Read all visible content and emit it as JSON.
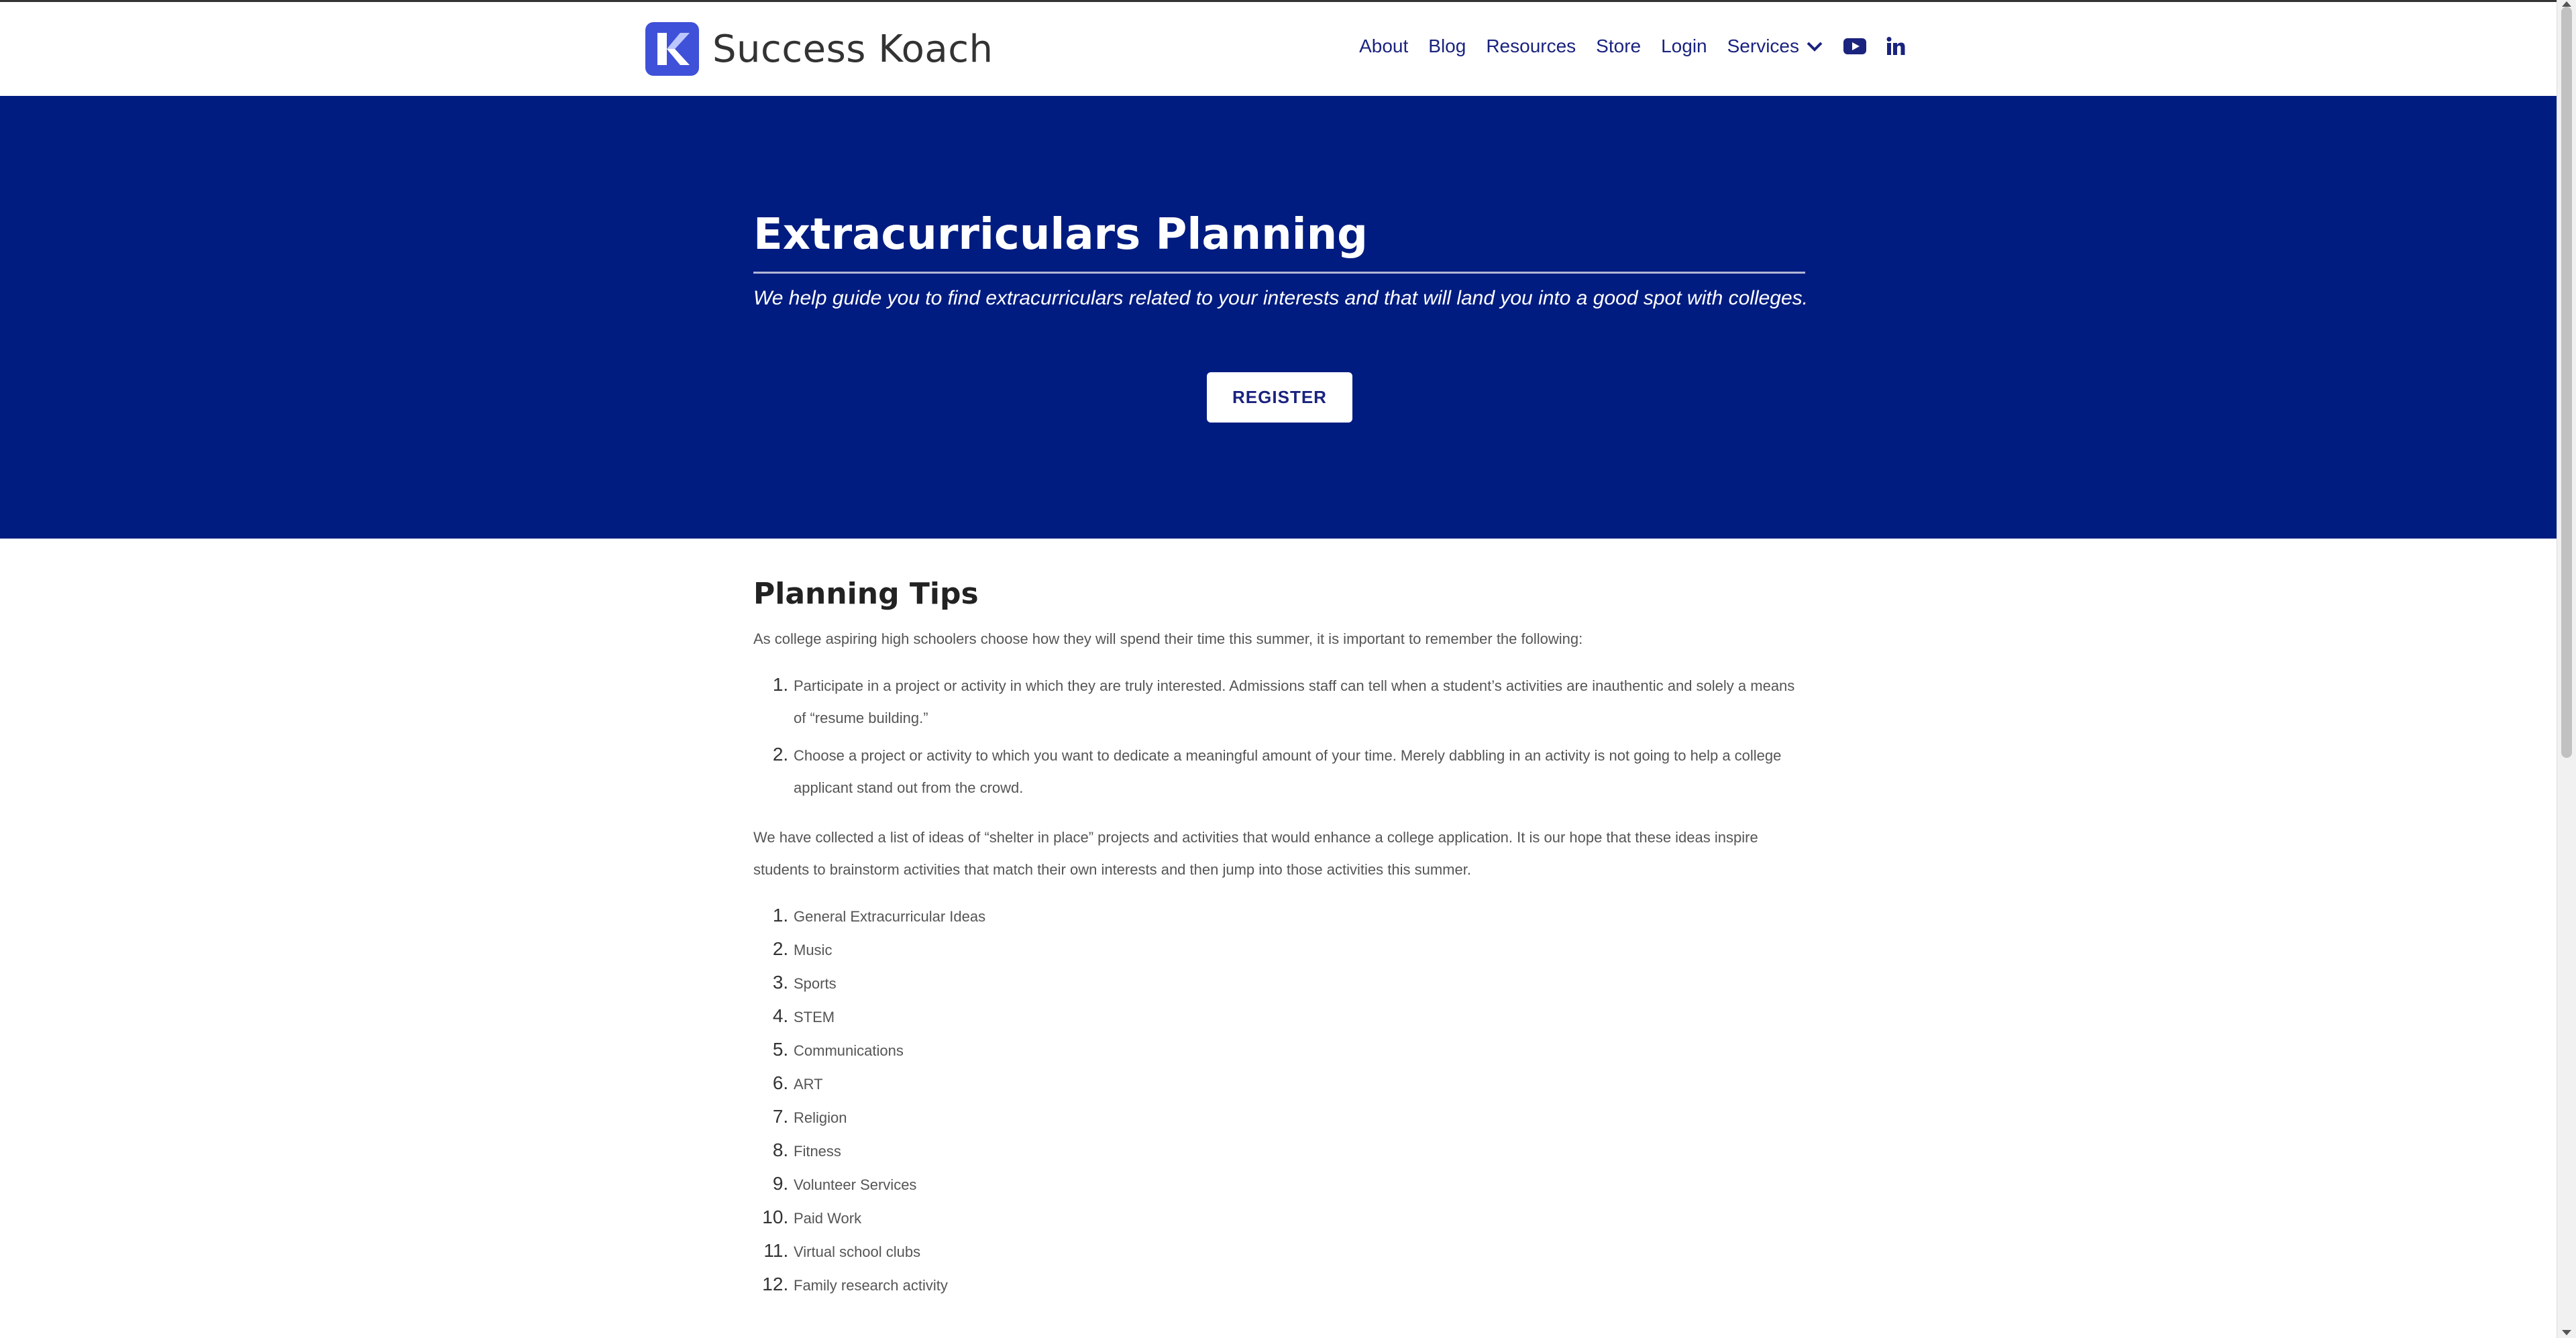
{
  "brand": {
    "name": "Success Koach",
    "accent": "#3f51d9",
    "hero_bg": "#001c80",
    "nav_color": "#1a237e"
  },
  "nav": {
    "items": [
      "About",
      "Blog",
      "Resources",
      "Store",
      "Login"
    ],
    "services_label": "Services",
    "youtube_icon": "youtube-icon",
    "linkedin_icon": "linkedin-icon"
  },
  "hero": {
    "title": "Extracurriculars Planning",
    "subtitle": "We help guide you to find extracurriculars related to your interests and that will land you into a good spot with colleges.",
    "register_label": "REGISTER"
  },
  "content": {
    "heading": "Planning Tips",
    "intro": "As college aspiring high schoolers choose how they will spend their time this summer, it is important to remember the following:",
    "tips": [
      "Participate in a project or activity in which they are truly interested. Admissions staff can tell when a student’s activities are inauthentic and solely a means of “resume building.”",
      "Choose a project or activity to which you want to dedicate a meaningful amount of your time. Merely dabbling in an activity is not going to help a college applicant stand out from the crowd."
    ],
    "paragraph": "We have collected a list of ideas of “shelter in place” projects and activities that would enhance a college application. It is our hope that these ideas inspire students to brainstorm activities that match their own interests and then jump into those activities this summer.",
    "ideas": [
      "General Extracurricular Ideas",
      "Music",
      "Sports",
      "STEM",
      "Communications",
      "ART",
      "Religion",
      "Fitness",
      "Volunteer Services",
      "Paid Work",
      "Virtual school clubs",
      "Family research activity"
    ]
  }
}
